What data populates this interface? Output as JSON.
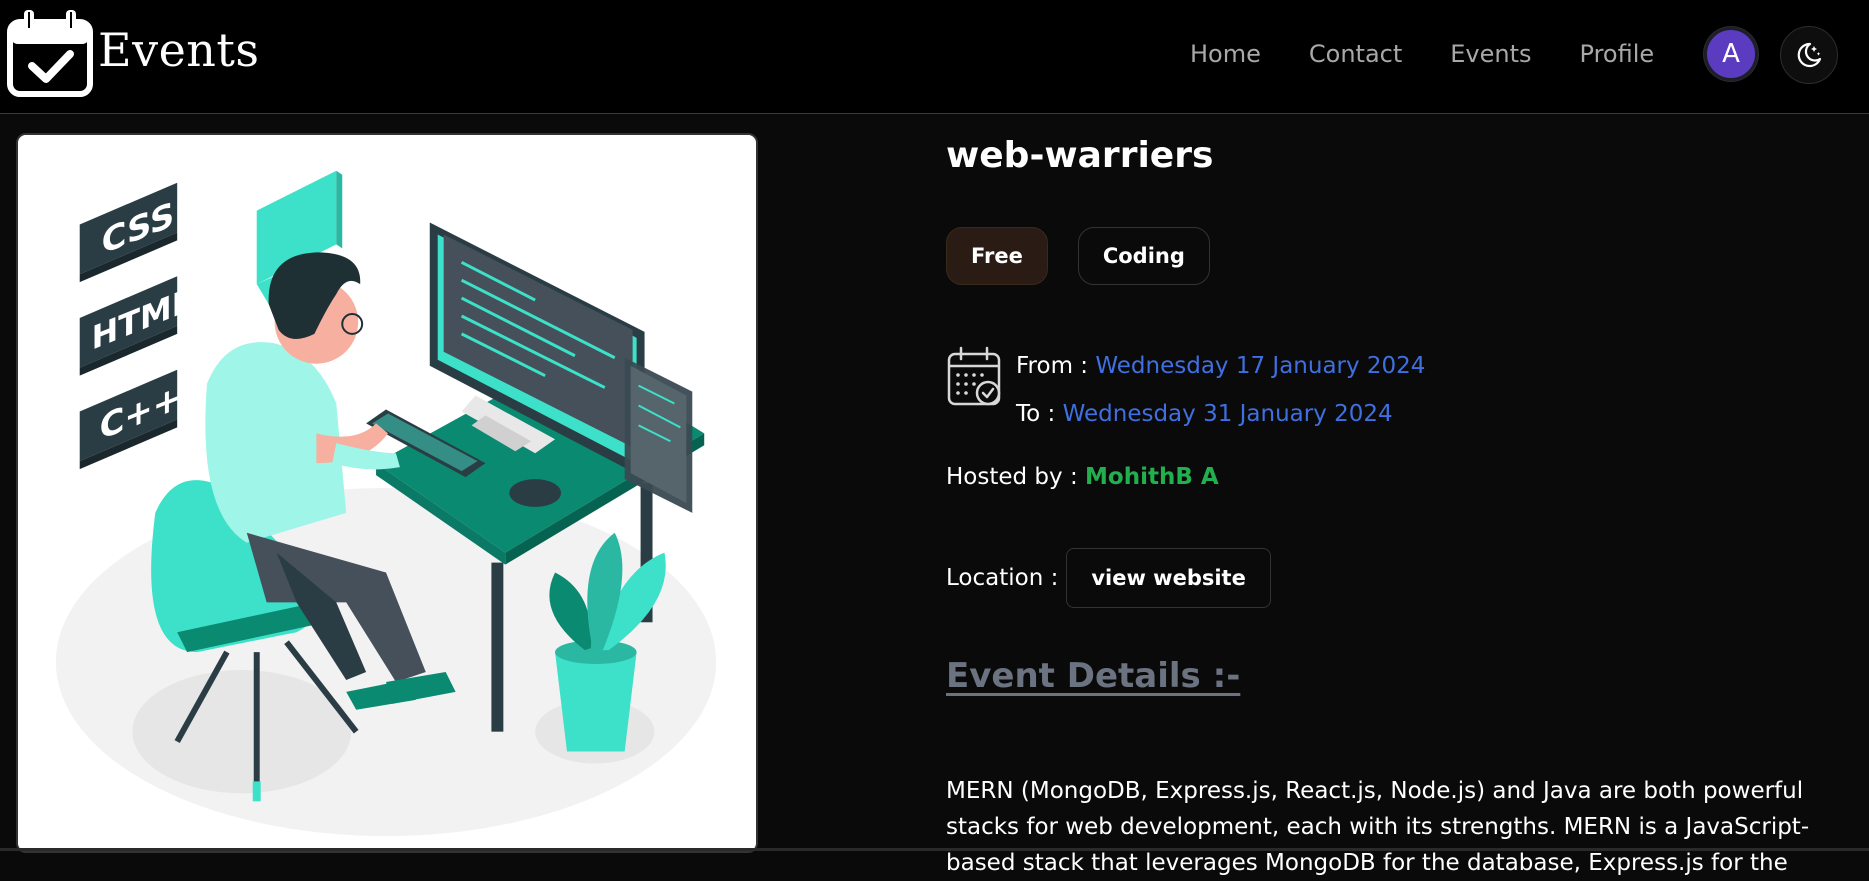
{
  "brand": {
    "title": "Events"
  },
  "nav": {
    "items": [
      {
        "label": "Home"
      },
      {
        "label": "Contact"
      },
      {
        "label": "Events"
      },
      {
        "label": "Profile"
      }
    ],
    "avatar_initial": "A"
  },
  "event": {
    "title": "web-warriers",
    "tags": [
      {
        "label": "Free"
      },
      {
        "label": "Coding"
      }
    ],
    "from_label": "From :",
    "from_date": "Wednesday 17 January 2024",
    "to_label": "To :",
    "to_date": "Wednesday 31 January 2024",
    "hosted_label": "Hosted by :",
    "host_name": "MohithB A",
    "location_label": "Location :",
    "location_button": "view website",
    "details_heading": "Event Details :-",
    "description": "MERN (MongoDB, Express.js, React.js, Node.js) and Java are both powerful stacks for web development, each with its strengths. MERN is a JavaScript-based stack that leverages MongoDB for the database, Express.js for the"
  },
  "illustration": {
    "badges": [
      "CSS",
      "HTML",
      "C++"
    ],
    "code_bubble": "</>"
  },
  "colors": {
    "date_link": "#3f6fe0",
    "host_name": "#22b04f",
    "avatar_bg": "#5b3bbf",
    "teal": "#3de0c8",
    "dark_teal": "#0a7a66"
  },
  "icons": {
    "brand": "calendar-check-icon",
    "theme": "moon-stars-icon",
    "dates": "calendar-clock-icon"
  }
}
